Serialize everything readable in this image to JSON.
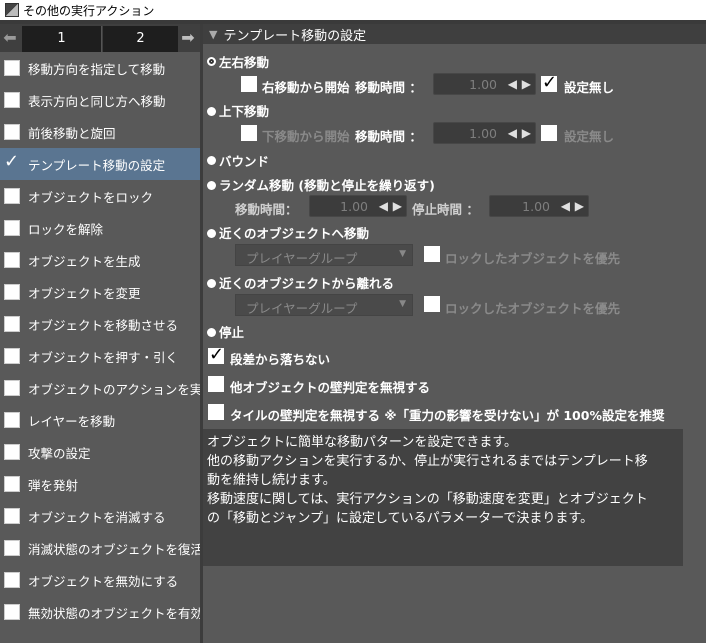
{
  "window": {
    "title": "その他の実行アクション"
  },
  "tabs": [
    "1",
    "2"
  ],
  "sidebar": {
    "items": [
      {
        "label": "移動方向を指定して移動",
        "checked": false
      },
      {
        "label": "表示方向と同じ方へ移動",
        "checked": false
      },
      {
        "label": "前後移動と旋回",
        "checked": false
      },
      {
        "label": "テンプレート移動の設定",
        "checked": true
      },
      {
        "label": "オブジェクトをロック",
        "checked": false
      },
      {
        "label": "ロックを解除",
        "checked": false
      },
      {
        "label": "オブジェクトを生成",
        "checked": false
      },
      {
        "label": "オブジェクトを変更",
        "checked": false
      },
      {
        "label": "オブジェクトを移動させる",
        "checked": false
      },
      {
        "label": "オブジェクトを押す・引く",
        "checked": false
      },
      {
        "label": "オブジェクトのアクションを実",
        "checked": false
      },
      {
        "label": "レイヤーを移動",
        "checked": false
      },
      {
        "label": "攻撃の設定",
        "checked": false
      },
      {
        "label": "弾を発射",
        "checked": false
      },
      {
        "label": "オブジェクトを消滅する",
        "checked": false
      },
      {
        "label": "消滅状態のオブジェクトを復活",
        "checked": false
      },
      {
        "label": "オブジェクトを無効にする",
        "checked": false
      },
      {
        "label": "無効状態のオブジェクトを有効",
        "checked": false
      }
    ]
  },
  "section": {
    "title": "テンプレート移動の設定"
  },
  "horizontal": {
    "label": "左右移動",
    "start_label": "右移動から開始",
    "time_label": "移動時間 ：",
    "time_value": "1.00",
    "unset_label": "設定無し"
  },
  "vertical": {
    "label": "上下移動",
    "start_label": "下移動から開始",
    "time_label": "移動時間 ：",
    "time_value": "1.00",
    "unset_label": "設定無し"
  },
  "bound": {
    "label": "バウンド"
  },
  "random": {
    "label": "ランダム移動 (移動と停止を繰り返す)",
    "move_time_label": "移動時間：",
    "move_time_value": "1.00",
    "stop_time_label": "停止時間 ：",
    "stop_time_value": "1.00"
  },
  "approach": {
    "label": "近くのオブジェクトへ移動",
    "group": "プレイヤーグループ",
    "lock_priority": "ロックしたオブジェクトを優先"
  },
  "depart": {
    "label": "近くのオブジェクトから離れる",
    "group": "プレイヤーグループ",
    "lock_priority": "ロックしたオブジェクトを優先"
  },
  "stop": {
    "label": "停止"
  },
  "options": {
    "no_fall": "段差から落ちない",
    "ignore_object_wall": "他オブジェクトの壁判定を無視する",
    "ignore_tile_wall": "タイルの壁判定を無視する ※「重力の影響を受けない」が 100%設定を推奨"
  },
  "description": {
    "lines": [
      "オブジェクトに簡単な移動パターンを設定できます。",
      "他の移動アクションを実行するか、停止が実行されるまではテンプレート移",
      "動を維持し続けます。",
      "移動速度に関しては、実行アクションの「移動速度を変更」とオブジェクト",
      "の「移動とジャンプ」に設定しているパラメーターで決まります。"
    ]
  },
  "colors": {
    "panel_bg": "#595959",
    "header_bg": "#3f3f3f",
    "selected_item": "#5a7591",
    "desc_bg": "#424242"
  }
}
